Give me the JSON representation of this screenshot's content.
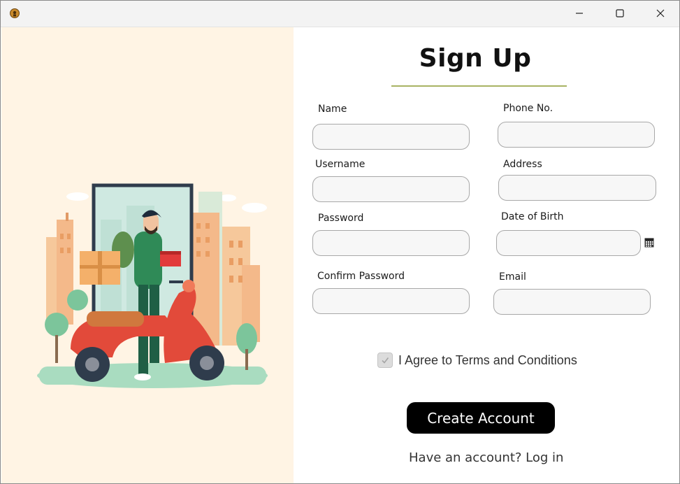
{
  "window": {
    "controls": [
      "minimize-icon",
      "maximize-icon",
      "close-icon"
    ]
  },
  "form": {
    "title": "Sign Up",
    "fields": {
      "name": {
        "label": "Name",
        "value": ""
      },
      "phone": {
        "label": "Phone No.",
        "value": ""
      },
      "username": {
        "label": "Username",
        "value": ""
      },
      "address": {
        "label": "Address",
        "value": ""
      },
      "password": {
        "label": "Password",
        "value": ""
      },
      "dob": {
        "label": "Date of Birth",
        "value": ""
      },
      "confirm_password": {
        "label": "Confirm Password",
        "value": ""
      },
      "email": {
        "label": "Email",
        "value": ""
      }
    },
    "agree": {
      "label": "I Agree to Terms and Conditions",
      "checked": true
    },
    "submit_label": "Create Account",
    "login_link": "Have an account? Log in"
  },
  "colors": {
    "left_panel_bg": "#fff4e4",
    "title_underline": "#a8b363",
    "button_bg": "#000000",
    "button_text": "#ffffff"
  }
}
